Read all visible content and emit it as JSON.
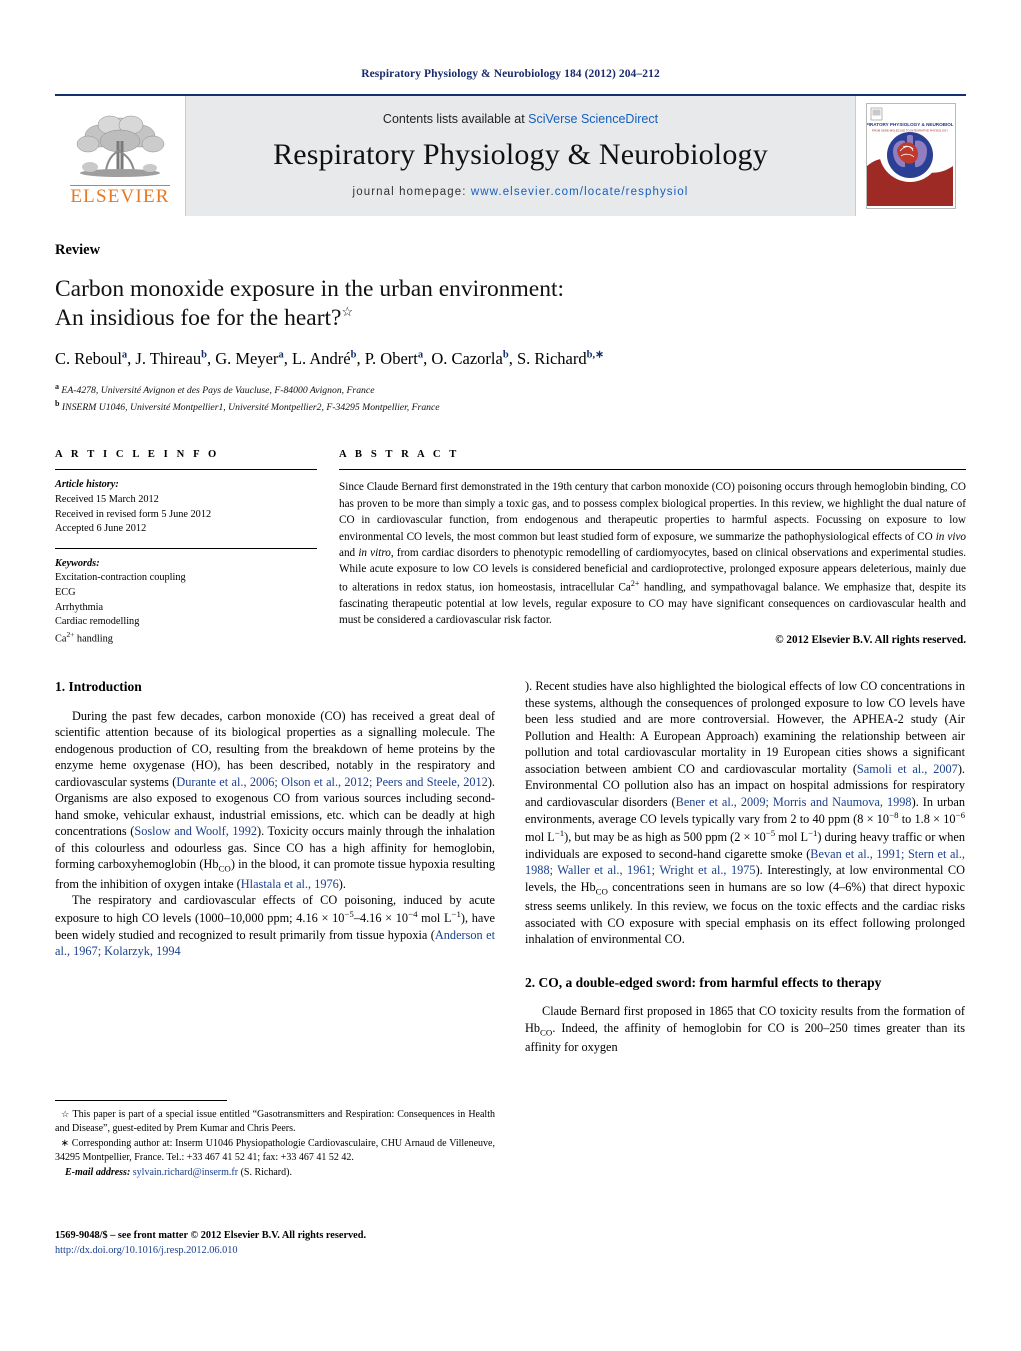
{
  "running_head": "Respiratory Physiology & Neurobiology 184 (2012) 204–212",
  "masthead": {
    "publisher_name": "ELSEVIER",
    "contents_prefix": "Contents lists available at ",
    "contents_link": "SciVerse ScienceDirect",
    "journal_title": "Respiratory Physiology & Neurobiology",
    "homepage_prefix": "journal homepage: ",
    "homepage_url": "www.elsevier.com/locate/resphysiol",
    "cover_title": "RESPIRATORY PHYSIOLOGY & NEUROBIOLOGY",
    "cover_subtitle": "FROM GENE-MOLECULE TO INTEGRATIVE PHYSIOLOGY",
    "brand_orange": "#E87722",
    "link_blue": "#1560bd",
    "rule_blue": "#12306b"
  },
  "article": {
    "type": "Review",
    "title_line1": "Carbon monoxide exposure in the urban environment:",
    "title_line2": "An insidious foe for the heart?",
    "title_footnote_marker": "☆",
    "authors": [
      {
        "name": "C. Reboul",
        "sup": "a"
      },
      {
        "name": "J. Thireau",
        "sup": "b"
      },
      {
        "name": "G. Meyer",
        "sup": "a"
      },
      {
        "name": "L. André",
        "sup": "b"
      },
      {
        "name": "P. Obert",
        "sup": "a"
      },
      {
        "name": "O. Cazorla",
        "sup": "b"
      },
      {
        "name": "S. Richard",
        "sup": "b,∗"
      }
    ],
    "affiliations": [
      {
        "marker": "a",
        "text": "EA-4278, Université Avignon et des Pays de Vaucluse, F-84000 Avignon, France"
      },
      {
        "marker": "b",
        "text": "INSERM U1046, Université Montpellier1, Université Montpellier2, F-34295 Montpellier, France"
      }
    ]
  },
  "info": {
    "heading": "A R T I C L E   I N F O",
    "history_label": "Article history:",
    "history": [
      "Received 15 March 2012",
      "Received in revised form 5 June 2012",
      "Accepted 6 June 2012"
    ],
    "keywords_label": "Keywords:",
    "keywords": [
      "Excitation-contraction coupling",
      "ECG",
      "Arrhythmia",
      "Cardiac remodelling",
      "Ca2+ handling"
    ]
  },
  "abstract": {
    "heading": "A B S T R A C T",
    "text_part1": "Since Claude Bernard first demonstrated in the 19th century that carbon monoxide (CO) poisoning occurs through hemoglobin binding, CO has proven to be more than simply a toxic gas, and to possess complex biological properties. In this review, we highlight the dual nature of CO in cardiovascular function, from endogenous and therapeutic properties to harmful aspects. Focussing on exposure to low environmental CO levels, the most common but least studied form of exposure, we summarize the pathophysiological effects of CO ",
    "italic1": "in vivo",
    "text_mid1": " and ",
    "italic2": "in vitro",
    "text_part2": ", from cardiac disorders to phenotypic remodelling of cardiomyocytes, based on clinical observations and experimental studies. While acute exposure to low CO levels is considered beneficial and cardioprotective, prolonged exposure appears deleterious, mainly due to alterations in redox status, ion homeostasis, intracellular Ca",
    "sup_ca": "2+",
    "text_part3": " handling, and sympathovagal balance. We emphasize that, despite its fascinating therapeutic potential at low levels, regular exposure to CO may have significant consequences on cardiovascular health and must be considered a cardiovascular risk factor.",
    "copyright": "© 2012 Elsevier B.V. All rights reserved."
  },
  "sections": {
    "s1_heading": "1.  Introduction",
    "s1_p1_a": "During the past few decades, carbon monoxide (CO) has received a great deal of scientific attention because of its biological properties as a signalling molecule. The endogenous production of CO, resulting from the breakdown of heme proteins by the enzyme heme oxygenase (HO), has been described, notably in the respiratory and cardiovascular systems (",
    "s1_p1_ref1": "Durante et al., 2006; Olson et al., 2012; Peers and Steele, 2012",
    "s1_p1_b": "). Organisms are also exposed to exogenous CO from various sources including second-hand smoke, vehicular exhaust, industrial emissions, etc. which can be deadly at high concentrations (",
    "s1_p1_ref2": "Soslow and Woolf, 1992",
    "s1_p1_c": "). Toxicity occurs mainly through the inhalation of this colourless and odourless gas. Since CO has a high affinity for hemoglobin, forming carboxyhemoglobin (Hb",
    "s1_p1_sub": "CO",
    "s1_p1_d": ") in the blood, it can promote tissue hypoxia resulting from the inhibition of oxygen intake (",
    "s1_p1_ref3": "Hlastala et al., 1976",
    "s1_p1_e": ").",
    "s1_p2_a": "The respiratory and cardiovascular effects of CO poisoning, induced by acute exposure to high CO levels (1000–10,000 ppm; 4.16 × 10",
    "s1_p2_sup1": "−5",
    "s1_p2_b": "–4.16 × 10",
    "s1_p2_sup2": "−4",
    "s1_p2_c": " mol L",
    "s1_p2_sup3": "−1",
    "s1_p2_d": "), have been widely studied and recognized to result primarily from tissue hypoxia (",
    "s1_p2_ref1": "Anderson et al., 1967; Kolarzyk, 1994",
    "s1_p2_e": "). Recent studies have also highlighted the biological effects of low CO concentrations in these systems, although the consequences of prolonged exposure to low CO levels have been less studied and are more controversial. However, the APHEA-2 study (Air Pollution and Health: A European Approach) examining the relationship between air pollution and total cardiovascular mortality in 19 European cities shows a significant association between ambient CO and cardiovascular mortality (",
    "s1_p2_ref2": "Samoli et al., 2007",
    "s1_p2_f": "). Environmental CO pollution also has an impact on hospital admissions for respiratory and cardiovascular disorders (",
    "s1_p2_ref3": "Bener et al., 2009; Morris and Naumova, 1998",
    "s1_p2_g": "). In urban environments, average CO levels typically vary from 2 to 40 ppm (8 × 10",
    "s1_p2_sup4": "−8",
    "s1_p2_h": " to 1.8 × 10",
    "s1_p2_sup5": "−6",
    "s1_p2_i": " mol L",
    "s1_p2_sup6": "−1",
    "s1_p2_j": "), but may be as high as 500 ppm (2 × 10",
    "s1_p2_sup7": "−5",
    "s1_p2_k": " mol L",
    "s1_p2_sup8": "−1",
    "s1_p2_l": ") during heavy traffic or when individuals are exposed to second-hand cigarette smoke (",
    "s1_p2_ref4": "Bevan et al., 1991; Stern et al., 1988; Waller et al., 1961; Wright et al., 1975",
    "s1_p2_m": "). Interestingly, at low environmental CO levels, the Hb",
    "s1_p2_sub": "CO",
    "s1_p2_n": " concentrations seen in humans are so low (4–6%) that direct hypoxic stress seems unlikely. In this review, we focus on the toxic effects and the cardiac risks associated with CO exposure with special emphasis on its effect following prolonged inhalation of environmental CO.",
    "s2_heading": "2.  CO, a double-edged sword: from harmful effects to therapy",
    "s2_p1_a": "Claude Bernard first proposed in 1865 that CO toxicity results from the formation of Hb",
    "s2_p1_sub": "CO",
    "s2_p1_b": ". Indeed, the affinity of hemoglobin for CO is 200–250 times greater than its affinity for oxygen"
  },
  "footnotes": {
    "star_marker": "☆",
    "special_issue": "This paper is part of a special issue entitled “Gasotransmitters and Respiration: Consequences in Health and Disease”, guest-edited by Prem Kumar and Chris Peers.",
    "corr_marker": "∗",
    "corresponding": "Corresponding author at: Inserm U1046 Physiopathologie Cardiovasculaire, CHU Arnaud de Villeneuve, 34295 Montpellier, France. Tel.: +33 467 41 52 41; fax: +33 467 41 52 42.",
    "email_label": "E-mail address:",
    "email": "sylvain.richard@inserm.fr",
    "email_suffix": "(S. Richard).",
    "front_matter": "1569-9048/$ – see front matter © 2012 Elsevier B.V. All rights reserved.",
    "doi": "http://dx.doi.org/10.1016/j.resp.2012.06.010"
  }
}
